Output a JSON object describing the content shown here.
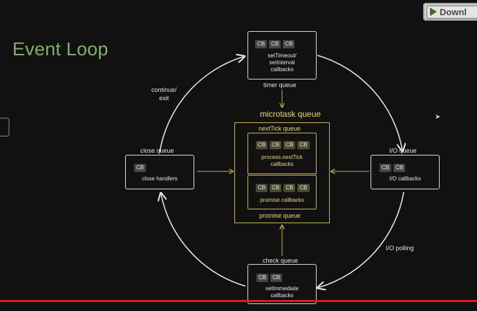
{
  "title": "Event Loop",
  "toolbar": {
    "download_label": "Downl"
  },
  "timer": {
    "label": "timer queue",
    "chips": [
      "CB",
      "CB",
      "CB"
    ],
    "text": "setTimeout/\nsetInterval\ncallbacks"
  },
  "close": {
    "label": "close queue",
    "chips": [
      "CB"
    ],
    "text": "close handlers"
  },
  "io": {
    "label": "I/O queue",
    "chips": [
      "CB",
      "CB"
    ],
    "text": "I/O callbacks"
  },
  "check": {
    "label": "check queue",
    "chips": [
      "CB",
      "CB"
    ],
    "text": "setImmediate\ncallbacks"
  },
  "microtask": {
    "title": "microtask queue",
    "nexttick": {
      "label": "nextTick queue",
      "chips": [
        "CB",
        "CB",
        "CB",
        "CB"
      ],
      "text": "process.nextTick\ncallbacks"
    },
    "promise": {
      "label": "promise queue",
      "chips": [
        "CB",
        "CB",
        "CB",
        "CB"
      ],
      "text": "promise callbacks"
    }
  },
  "arcs": {
    "continue_exit": "continue/\nexit",
    "io_polling": "I/O polling"
  },
  "colors": {
    "title": "#7fb069",
    "microtask": "#ecd97a",
    "border": "#dcdcdc",
    "red_line": "#e01b1b"
  }
}
